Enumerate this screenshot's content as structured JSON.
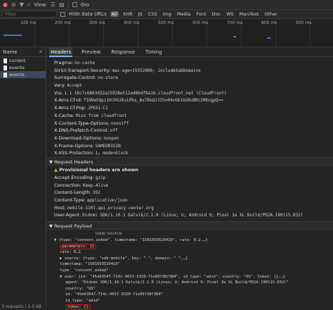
{
  "toolbar": {
    "preserve_log_label": "View:",
    "group_label": "Gro"
  },
  "filterbar": {
    "filter_placeholder": "Filter",
    "hide_data_urls": "Hide data URLs",
    "types": [
      "All",
      "XHR",
      "JS",
      "CSS",
      "Img",
      "Media",
      "Font",
      "Doc",
      "WS",
      "Manifest",
      "Other"
    ],
    "active_type": "All"
  },
  "timeline": {
    "ticks": [
      "100 ms",
      "200 ms",
      "300 ms",
      "400 ms",
      "500 ms",
      "600 ms",
      "700 ms",
      "800 ms",
      "900 ms"
    ]
  },
  "sidebar": {
    "header": "Name",
    "items": [
      {
        "label": "current",
        "selected": false
      },
      {
        "label": "events",
        "selected": false
      },
      {
        "label": "events",
        "selected": true
      }
    ],
    "footer": "3 requests | 2.5 KB"
  },
  "tabs": [
    "Headers",
    "Preview",
    "Response",
    "Timing"
  ],
  "active_tab": "Headers",
  "response_headers": [
    {
      "key": "Pragma:",
      "value": "no-cache"
    },
    {
      "key": "Strict-Transport-Security:",
      "value": "max-age=15552000; includeSubDomains"
    },
    {
      "key": "Surrogate-Control:",
      "value": "no-store"
    },
    {
      "key": "Vary:",
      "value": "Accept"
    },
    {
      "key": "Via:",
      "value": "1.1 18c7c6863d32a25928e512ad864f8a19.cloudfront.net (CloudFront)"
    },
    {
      "key": "X-Amz-Cf-Id:",
      "value": "TIN9e5Qpz1HJVG2kvLRhs_Ax78kQJJIhn04vGb1SG0uBRc2RKogpQ=="
    },
    {
      "key": "X-Amz-Cf-Pop:",
      "value": "JFK51-C1"
    },
    {
      "key": "X-Cache:",
      "value": "Miss from cloudfront"
    },
    {
      "key": "X-Content-Type-Options:",
      "value": "nosniff"
    },
    {
      "key": "X-DNS-Prefetch-Control:",
      "value": "off"
    },
    {
      "key": "X-Download-Options:",
      "value": "noopen"
    },
    {
      "key": "X-Frame-Options:",
      "value": "SAMEORIGIN"
    },
    {
      "key": "X-XSS-Protection:",
      "value": "1; mode=block"
    }
  ],
  "request_headers_title": "▼ Request Headers",
  "provisional_warning": "Provisional headers are shown",
  "request_headers": [
    {
      "key": "Accept-Encoding:",
      "value": "gzip"
    },
    {
      "key": "Connection:",
      "value": "Keep-Alive"
    },
    {
      "key": "Content-Length:",
      "value": "392"
    },
    {
      "key": "Content-Type:",
      "value": "application/json"
    },
    {
      "key": "Host:",
      "value": "mobile-1101.api.privacy-center.org"
    },
    {
      "key": "User-Agent:",
      "value": "Didomi SDK/1.10.1 Dalvik/2.1.0 (Linux; U; Android 9; Pixel 3a XL Build/PD2A.190115.032)"
    }
  ],
  "request_payload_title": "▼ Request Payload",
  "view_source": "view source",
  "payload_lines": [
    "▼ {type: \"consent.asked\", timestamp: \"1581693520419\", rate: 0.2,…}",
    "parameters: {}",
    "rate: 0.2",
    "▶ source: {type: \"sdk-mobile\", key: \"                    \", domain: \"           \",…}",
    "timestamp: \"1581693520419\"",
    "type: \"consent.asked\"",
    "▼ user: {id: \"45e63547-714c-465f-9320-71e89f38f384\", id_type: \"adid\", country: \"US\", token: {},…}",
    "agent: \"Didomi SDK/1.10.1 Dalvik/2.1.0 (Linux; U; Android 9; Pixel 3a XL Build/PD2A.190115.032)\"",
    "country: \"US\"",
    "id: \"45e63547-714c-465f-9320-71e89f38f384\"",
    "id_type: \"adid\"",
    "token: {}"
  ]
}
